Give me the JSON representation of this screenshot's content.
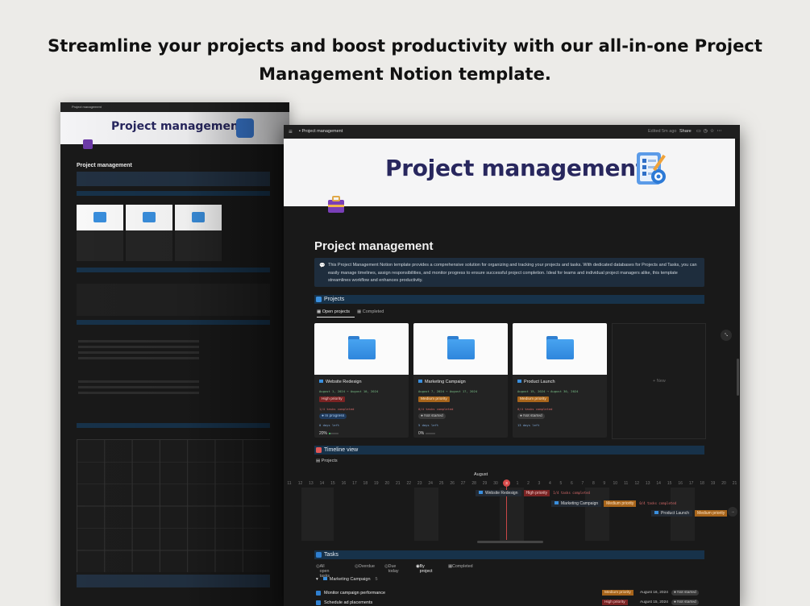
{
  "headline": {
    "line1": "Streamline your projects and boost productivity with our all-in-one Project",
    "line2": "Management Notion template."
  },
  "back_window": {
    "breadcrumb": "Project management",
    "banner_title": "Project management",
    "page_title": "Project management"
  },
  "window": {
    "breadcrumb": "Project management",
    "edited": "Edited 5m ago",
    "share": "Share",
    "icons": [
      "comment-icon",
      "clock-icon",
      "star-icon",
      "more-icon"
    ]
  },
  "banner": {
    "title": "Project management"
  },
  "page": {
    "title": "Project management",
    "callout_icon": "💬",
    "description": "This Project Management Notion template provides a comprehensive solution for organizing and tracking your projects and tasks. With dedicated databases for Projects and Tasks, you can easily manage timelines, assign responsibilities, and monitor progress to ensure successful project completion. Ideal for teams and individual project managers alike, this template streamlines workflow and enhances productivity."
  },
  "projects": {
    "heading": "Projects",
    "tabs": [
      "Open projects",
      "Completed"
    ],
    "new_label": "+ New",
    "cards": [
      {
        "title": "Website Redesign",
        "dates": "August 1, 2024 → August 10, 2024",
        "priority": "High priority",
        "tasks": "1/4 tasks completed",
        "status": "In progress",
        "days": "0 days left",
        "progress_label": "20%",
        "progress": 0.2
      },
      {
        "title": "Marketing Campaign",
        "dates": "August 7, 2024 → August 17, 2024",
        "priority": "Medium priority",
        "tasks": "0/4 tasks completed",
        "status": "Not started",
        "days": "5 days left",
        "progress_label": "0%",
        "progress": 0
      },
      {
        "title": "Product Launch",
        "dates": "August 15, 2024 → August 30, 2024",
        "priority": "Medium priority",
        "tasks": "0/4 tasks completed",
        "status": "Not started",
        "days": "13 days left",
        "progress_label": "",
        "progress": 0
      }
    ]
  },
  "timeline": {
    "heading": "Timeline view",
    "view_label": "Projects",
    "month": "August",
    "days": [
      "11",
      "12",
      "13",
      "14",
      "15",
      "16",
      "17",
      "18",
      "19",
      "20",
      "21",
      "22",
      "23",
      "24",
      "25",
      "26",
      "27",
      "28",
      "29",
      "30",
      "31",
      "1",
      "2",
      "3",
      "4",
      "5",
      "6",
      "7",
      "8",
      "9",
      "10",
      "11",
      "12",
      "13",
      "14",
      "15",
      "16",
      "17",
      "18",
      "19",
      "20",
      "21"
    ],
    "today": "3",
    "bars": [
      {
        "name": "Website Redesign",
        "priority": "High priority",
        "tasks": "1/4 tasks completed"
      },
      {
        "name": "Marketing Campaign",
        "priority": "Medium priority",
        "tasks": "0/4 tasks completed"
      },
      {
        "name": "Product Launch",
        "priority": "Medium priority"
      }
    ]
  },
  "tasks": {
    "heading": "Tasks",
    "tabs": [
      "All open tasks",
      "Overdue",
      "Due today",
      "By project",
      "Completed"
    ],
    "group": {
      "name": "Marketing Campaign",
      "count": "5"
    },
    "rows": [
      {
        "name": "Monitor campaign performance",
        "priority": "Medium priority",
        "date": "August 16, 2024",
        "status": "Not started"
      },
      {
        "name": "Schedule ad placements",
        "priority": "High priority",
        "date": "August 15, 2024",
        "status": "Not started"
      }
    ]
  },
  "colors": {
    "bg": "#ecebe8",
    "window": "#191919",
    "section": "#17324a",
    "accent": "#2f7fd0",
    "high": "#7a2323",
    "medium": "#a8651b",
    "green": "#3fae5a"
  }
}
